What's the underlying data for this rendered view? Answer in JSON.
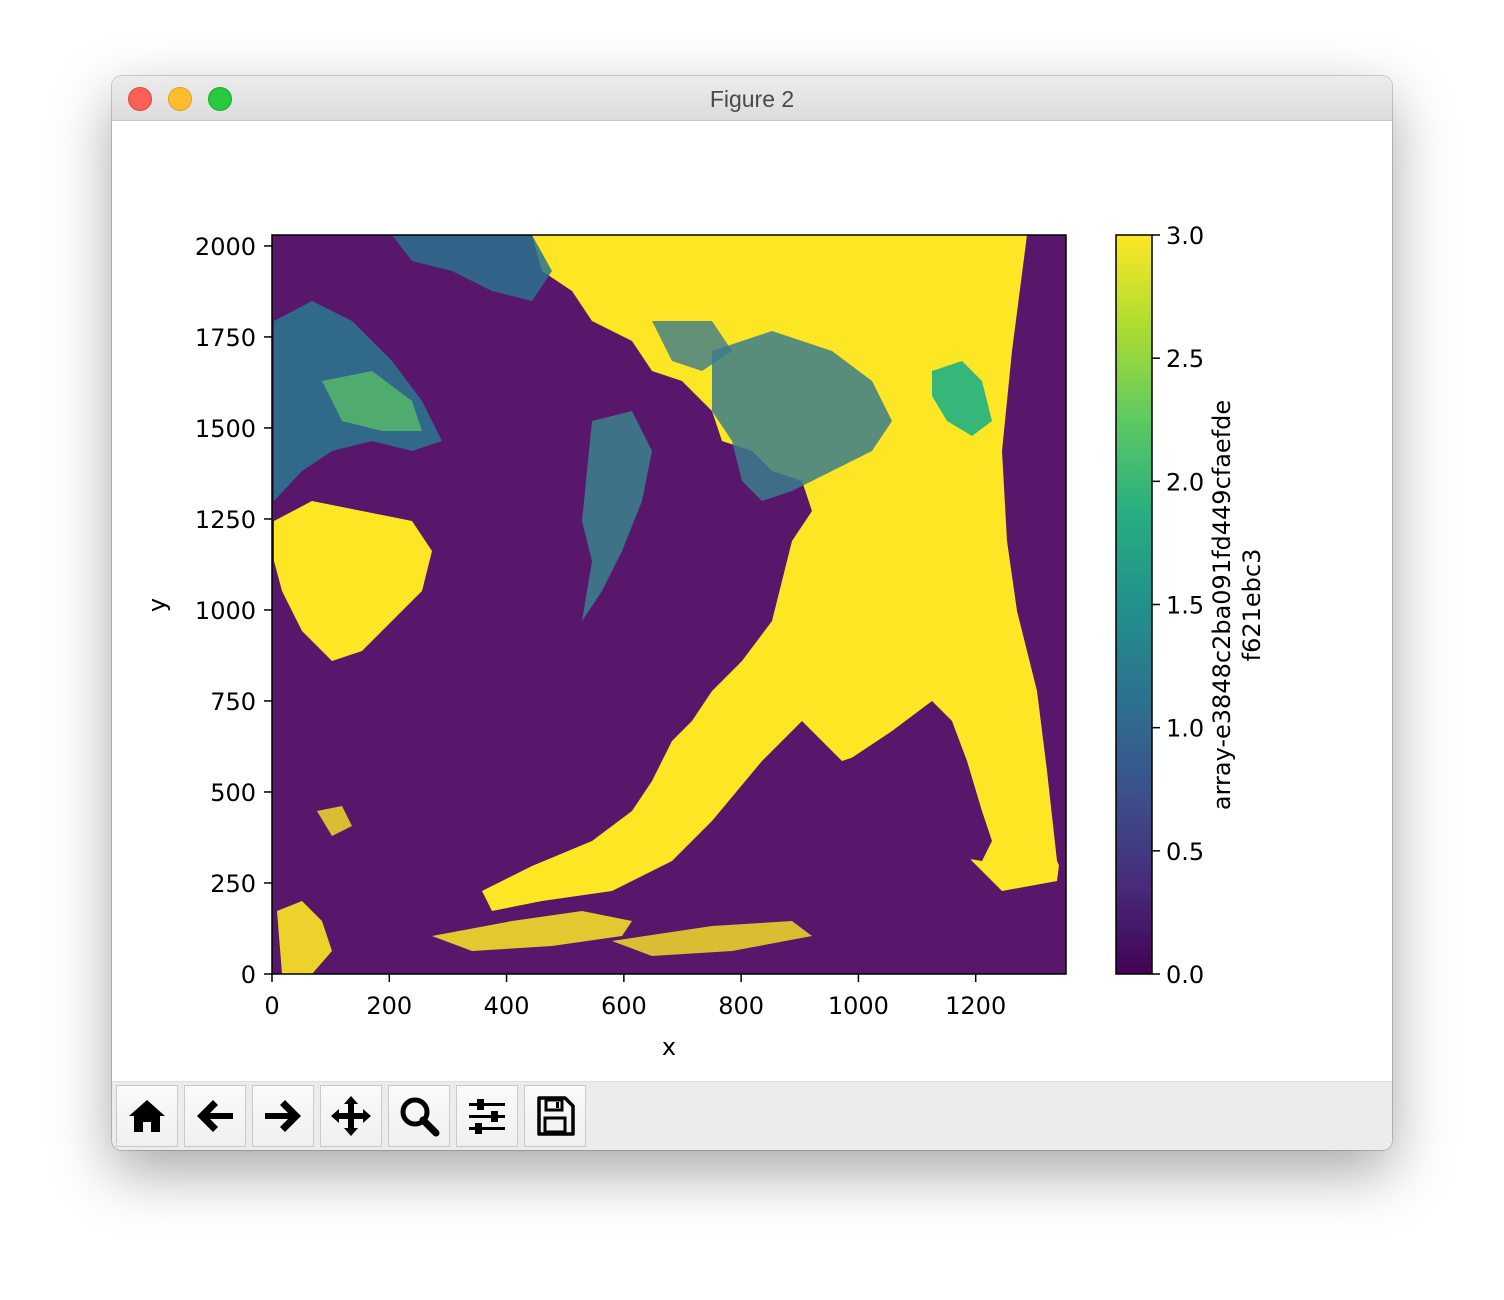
{
  "window": {
    "title": "Figure 2"
  },
  "toolbar": {
    "buttons": [
      {
        "name": "home-button",
        "icon": "home-icon"
      },
      {
        "name": "back-button",
        "icon": "arrow-left-icon"
      },
      {
        "name": "forward-button",
        "icon": "arrow-right-icon"
      },
      {
        "name": "pan-button",
        "icon": "move-icon"
      },
      {
        "name": "zoom-button",
        "icon": "magnifier-icon"
      },
      {
        "name": "subplots-button",
        "icon": "sliders-icon"
      },
      {
        "name": "save-button",
        "icon": "floppy-disk-icon"
      }
    ]
  },
  "chart_data": {
    "type": "heatmap",
    "title": "",
    "xlabel": "x",
    "ylabel": "y",
    "xlim": [
      0,
      1354
    ],
    "ylim": [
      0,
      2030
    ],
    "xticks": [
      "0",
      "200",
      "400",
      "600",
      "800",
      "1000",
      "1200"
    ],
    "xtick_values": [
      0,
      200,
      400,
      600,
      800,
      1000,
      1200
    ],
    "yticks": [
      "0",
      "250",
      "500",
      "750",
      "1000",
      "1250",
      "1500",
      "1750",
      "2000"
    ],
    "ytick_values": [
      0,
      250,
      500,
      750,
      1000,
      1250,
      1500,
      1750,
      2000
    ],
    "colormap": "viridis",
    "colorbar": {
      "label": "array-e3848c2ba091fd449cfaefde\nf621ebc3",
      "label_line1": "array-e3848c2ba091fd449cfaefde",
      "label_line2": "f621ebc3",
      "ticks": [
        "0.0",
        "0.5",
        "1.0",
        "1.5",
        "2.0",
        "2.5",
        "3.0"
      ],
      "tick_values": [
        0.0,
        0.5,
        1.0,
        1.5,
        2.0,
        2.5,
        3.0
      ],
      "range": [
        0.0,
        3.0
      ]
    },
    "colors": {
      "low": "#440154",
      "background": "#58176b",
      "mid": "#21918c",
      "cyan": "#3b7c8c",
      "high": "#fde725",
      "green": "#35b779"
    }
  }
}
